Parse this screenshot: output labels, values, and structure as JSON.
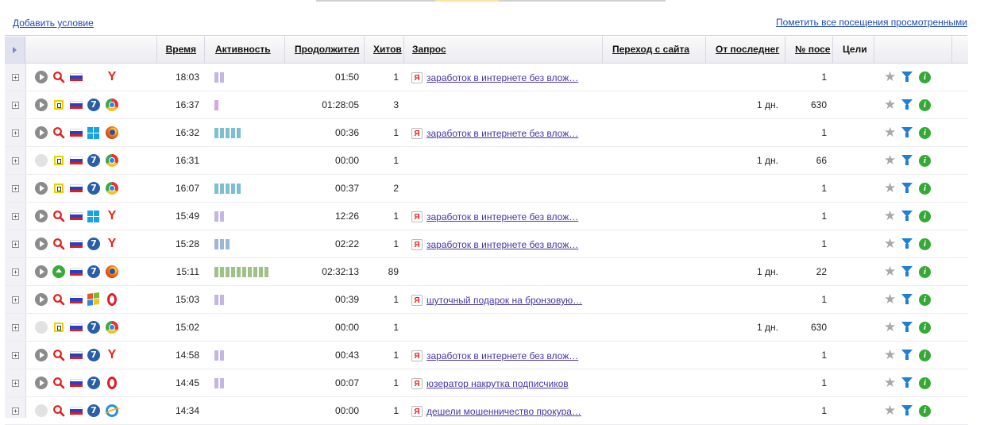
{
  "toolbar": {
    "add_condition": "Добавить условие",
    "mark_all_viewed": "Пометить все посещения просмотренными"
  },
  "header": {
    "time": "Время",
    "activity": "Активность",
    "duration": "Продолжител",
    "hits": "Хитов",
    "query": "Запрос",
    "referrer": "Переход с сайта",
    "since_last": "От последнег",
    "visit_no": "№ посе",
    "goals": "Цели"
  },
  "colors": {
    "link": "#1e4bb5",
    "query_link": "#4a35a8",
    "activity_low": "#c3b5e6",
    "activity_mid": "#7cbfd1",
    "activity_high": "#9cc286"
  },
  "rows": [
    {
      "time": "18:03",
      "activity": 2,
      "activity_color": "#c3b5e6",
      "duration": "01:50",
      "hits": "1",
      "query": "заработок в интернете без влож…",
      "since_last": "",
      "visit_no": "1",
      "source": "search-icon",
      "os": "",
      "browser": "yandex-browser-icon",
      "played": true
    },
    {
      "time": "16:37",
      "activity": 1,
      "activity_color": "#d8a6e3",
      "duration": "01:28:05",
      "hits": "3",
      "query": "",
      "since_last": "1 дн.",
      "visit_no": "630",
      "source": "direct-icon",
      "os": "windows7-icon",
      "browser": "chrome-icon",
      "played": true
    },
    {
      "time": "16:32",
      "activity": 5,
      "activity_color": "#7cbfd1",
      "duration": "00:36",
      "hits": "1",
      "query": "заработок в интернете без влож…",
      "since_last": "",
      "visit_no": "1",
      "source": "search-icon",
      "os": "windows8-icon",
      "browser": "firefox-icon",
      "played": true
    },
    {
      "time": "16:31",
      "activity": 0,
      "activity_color": "#c3b5e6",
      "duration": "00:00",
      "hits": "1",
      "query": "",
      "since_last": "1 дн.",
      "visit_no": "66",
      "source": "direct-icon",
      "os": "windows7-icon",
      "browser": "chrome-icon",
      "played": false
    },
    {
      "time": "16:07",
      "activity": 5,
      "activity_color": "#7cbfd1",
      "duration": "00:37",
      "hits": "2",
      "query": "",
      "since_last": "",
      "visit_no": "1",
      "source": "direct-icon",
      "os": "windows7-icon",
      "browser": "chrome-icon",
      "played": true
    },
    {
      "time": "15:49",
      "activity": 2,
      "activity_color": "#c3b5e6",
      "duration": "12:26",
      "hits": "1",
      "query": "заработок в интернете без влож…",
      "since_last": "",
      "visit_no": "1",
      "source": "search-icon",
      "os": "windows8-icon",
      "browser": "yandex-browser-icon",
      "played": true
    },
    {
      "time": "15:28",
      "activity": 3,
      "activity_color": "#99b8d8",
      "duration": "02:22",
      "hits": "1",
      "query": "заработок в интернете без влож…",
      "since_last": "",
      "visit_no": "1",
      "source": "search-icon",
      "os": "windows7-icon",
      "browser": "yandex-browser-icon",
      "played": true
    },
    {
      "time": "15:11",
      "activity": 10,
      "activity_color": "#9cc286",
      "duration": "02:32:13",
      "hits": "89",
      "query": "",
      "since_last": "1 дн.",
      "visit_no": "22",
      "source": "internal-link-icon",
      "os": "windows7-icon",
      "browser": "firefox-icon",
      "played": true
    },
    {
      "time": "15:03",
      "activity": 2,
      "activity_color": "#c3b5e6",
      "duration": "00:39",
      "hits": "1",
      "query": "шуточный подарок на бронзовую…",
      "since_last": "",
      "visit_no": "1",
      "source": "search-icon",
      "os": "windowsxp-icon",
      "browser": "opera-icon",
      "played": true
    },
    {
      "time": "15:02",
      "activity": 0,
      "activity_color": "#c3b5e6",
      "duration": "00:00",
      "hits": "1",
      "query": "",
      "since_last": "1 дн.",
      "visit_no": "630",
      "source": "direct-icon",
      "os": "windows7-icon",
      "browser": "chrome-icon",
      "played": false
    },
    {
      "time": "14:58",
      "activity": 2,
      "activity_color": "#c3b5e6",
      "duration": "00:43",
      "hits": "1",
      "query": "заработок в интернете без влож…",
      "since_last": "",
      "visit_no": "1",
      "source": "search-icon",
      "os": "windows7-icon",
      "browser": "yandex-browser-icon",
      "played": true
    },
    {
      "time": "14:45",
      "activity": 2,
      "activity_color": "#c3b5e6",
      "duration": "00:07",
      "hits": "1",
      "query": "юзератор накрутка подписчиков",
      "since_last": "",
      "visit_no": "1",
      "source": "search-icon",
      "os": "windows7-icon",
      "browser": "opera-icon",
      "played": true
    },
    {
      "time": "14:34",
      "activity": 0,
      "activity_color": "#c3b5e6",
      "duration": "00:00",
      "hits": "1",
      "query": "дешели мошенничество прокура…",
      "since_last": "",
      "visit_no": "1",
      "source": "search-icon",
      "os": "windows7-icon",
      "browser": "ie-icon",
      "played": false
    }
  ]
}
